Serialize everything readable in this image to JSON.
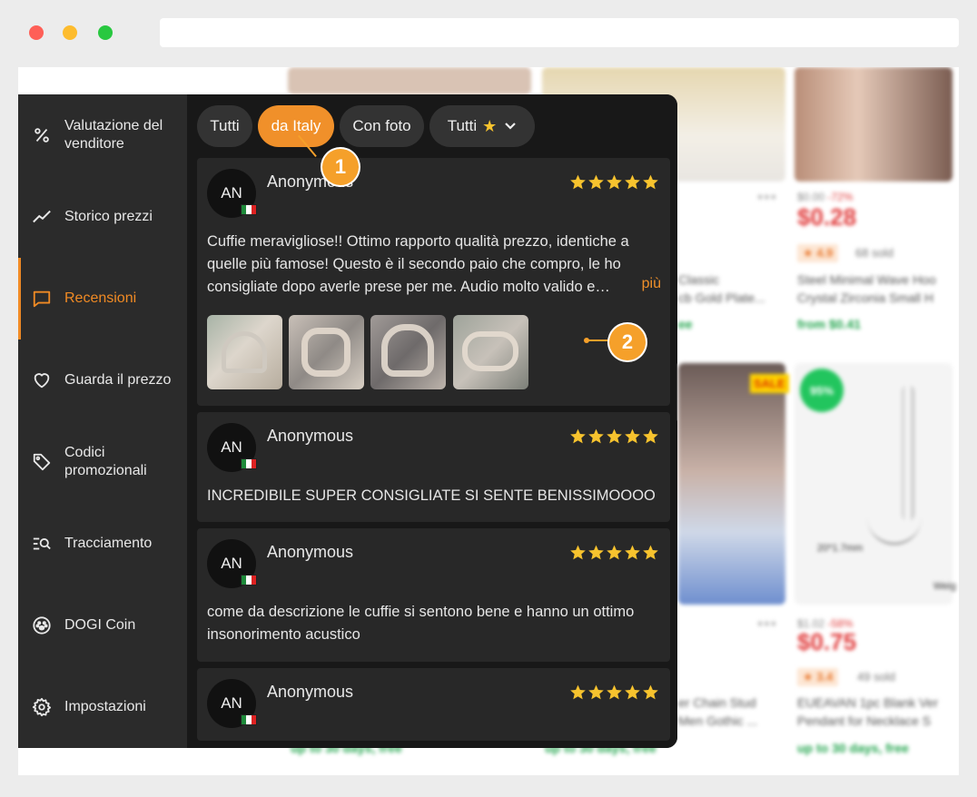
{
  "sidebar": {
    "items": [
      {
        "label": "Valutazione del venditore",
        "icon": "percent-icon"
      },
      {
        "label": "Storico prezzi",
        "icon": "trend-line-icon"
      },
      {
        "label": "Recensioni",
        "icon": "chat-icon",
        "active": true
      },
      {
        "label": "Guarda il prezzo",
        "icon": "heart-icon"
      },
      {
        "label": "Codici promozionali",
        "icon": "tag-icon"
      },
      {
        "label": "Tracciamento",
        "icon": "tracking-search-icon"
      },
      {
        "label": "DOGI Coin",
        "icon": "paw-coin-icon"
      },
      {
        "label": "Impostazioni",
        "icon": "gear-icon"
      }
    ]
  },
  "filters": {
    "all": "Tutti",
    "country": "da Italy",
    "with_photo": "Con foto",
    "stars": "Tutti"
  },
  "reviews": [
    {
      "initials": "AN",
      "name": "Anonymous",
      "rating": 5,
      "country": "Italy",
      "text": "Cuffie meravigliose!! Ottimo rapporto qualità prezzo, identiche a quelle più famose! Questo è il secondo paio che compro, le ho consigliate dopo averle prese per me. Audio molto valido e…",
      "more": "più"
    },
    {
      "initials": "AN",
      "name": "Anonymous",
      "rating": 5,
      "country": "Italy",
      "text": "INCREDIBILE SUPER CONSIGLIATE SI SENTE BENISSIMOOOO"
    },
    {
      "initials": "AN",
      "name": "Anonymous",
      "rating": 5,
      "country": "Italy",
      "text": "come da descrizione le cuffie si sentono bene e hanno un ottimo insonorimento acustico"
    },
    {
      "initials": "AN",
      "name": "Anonymous",
      "rating": 5,
      "country": "Italy",
      "text": ""
    }
  ],
  "callouts": [
    "1",
    "2"
  ],
  "background_products": {
    "p1": {
      "strike": "$0.00",
      "discount": "-72%",
      "price": "$0.28",
      "rating": "★ 4.9",
      "sold": "68 sold",
      "title1": "Steel Minimal Wave Hoo",
      "title2": "Crystal Zirconia Small H",
      "ship": "from $0.41"
    },
    "p2": {
      "title1": "Classic",
      "title2": "cb Gold Plate..."
    },
    "p3": {
      "strike": "$1.02",
      "discount": "-58%",
      "price": "$0.75",
      "rating": "★ 3.4",
      "sold": "49 sold",
      "title1": "EUEAVAN 1pc Blank Ver",
      "title2": "Pendant for Necklace S",
      "ship": "up to 30 days, free",
      "size": "20*1.7mm",
      "pct": "95%",
      "weight": "Weig"
    },
    "p4": {
      "title1": "er Chain Stud",
      "title2": "Men Gothic ...",
      "ship": "up to 30 days, free",
      "sale": "SALE"
    },
    "p5": {
      "ship": "up to 30 days, free"
    }
  },
  "colors": {
    "accent": "#f0902a",
    "star": "#f7c32e",
    "panel_bg": "#181818",
    "sidebar_bg": "#2b2b2b",
    "card_bg": "#282828"
  }
}
